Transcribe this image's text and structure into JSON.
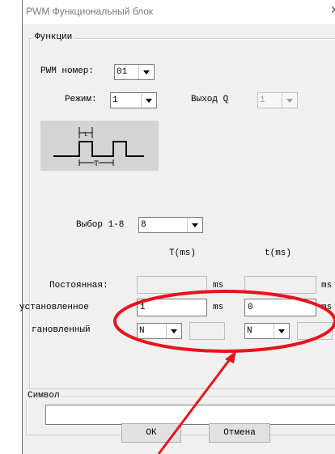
{
  "window": {
    "title": "PWM Функциональный блок",
    "close_icon": "close-icon"
  },
  "functions": {
    "legend": "Функции",
    "pwm_label": "PWM номер:",
    "pwm_value": "01",
    "mode_label": "Режим:",
    "mode_value": "1",
    "output_label": "Выход Q",
    "output_value": "1",
    "diagram": {
      "high_time_label": "t",
      "period_label": "T"
    },
    "select_label": "Выбор 1-8",
    "select_value": "8",
    "col_T": "T(ms)",
    "col_t": "t(ms)",
    "rows": [
      {
        "label": "Постоянная:",
        "T_value": "",
        "T_unit": "ms",
        "t_value": "",
        "t_unit": "ms"
      },
      {
        "label": "установленное",
        "T_value": "1",
        "T_unit": "ms",
        "t_value": "0",
        "t_unit": "ms"
      },
      {
        "label": "гановленный",
        "T_combo": "N",
        "t_combo": "N"
      }
    ]
  },
  "symbol": {
    "legend": "Символ",
    "value": ""
  },
  "buttons": {
    "ok": "OK",
    "cancel": "Отмена"
  },
  "annotation": {
    "color": "#e8141c"
  }
}
